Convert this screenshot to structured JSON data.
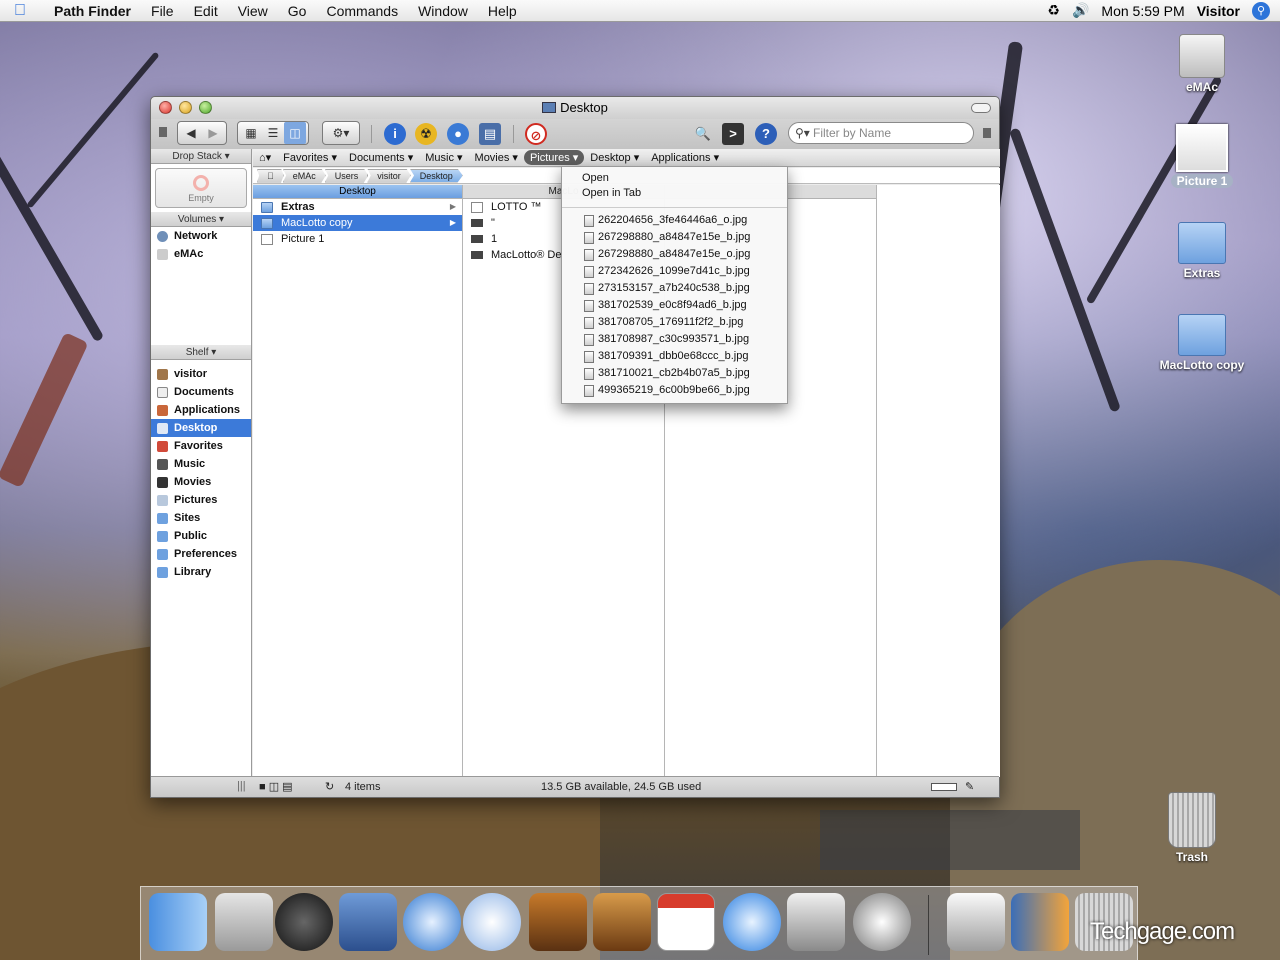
{
  "menubar": {
    "app_name": "Path Finder",
    "items": [
      "File",
      "Edit",
      "View",
      "Go",
      "Commands",
      "Window",
      "Help"
    ],
    "clock": "Mon 5:59 PM",
    "user": "Visitor"
  },
  "desktop_icons": [
    {
      "label": "eMAc"
    },
    {
      "label": "Picture 1"
    },
    {
      "label": "Extras"
    },
    {
      "label": "MacLotto copy"
    },
    {
      "label": "Trash"
    }
  ],
  "window": {
    "title": "Desktop",
    "search_placeholder": "Filter by Name",
    "sidebar": {
      "drop_stack_header": "Drop Stack",
      "drop_stack_empty": "Empty",
      "volumes_header": "Volumes",
      "volumes": [
        "Network",
        "eMAc"
      ],
      "shelf_header": "Shelf",
      "shelf": [
        "visitor",
        "Documents",
        "Applications",
        "Desktop",
        "Favorites",
        "Music",
        "Movies",
        "Pictures",
        "Sites",
        "Public",
        "Preferences",
        "Library"
      ],
      "selected_shelf": "Desktop"
    },
    "favorites_bar": [
      "Favorites",
      "Documents",
      "Music",
      "Movies",
      "Pictures",
      "Desktop",
      "Applications"
    ],
    "open_favorite": "Pictures",
    "breadcrumb": [
      "eMAc",
      "Users",
      "visitor",
      "Desktop"
    ],
    "columns": [
      {
        "header": "Desktop",
        "items": [
          "Extras",
          "MacLotto copy",
          "Picture 1"
        ],
        "selected": "MacLotto copy"
      },
      {
        "header": "MacLo",
        "items": [
          "LOTTO ™",
          "\"",
          "1",
          "MacLotto® De"
        ]
      }
    ],
    "status": {
      "item_count": "4 items",
      "disk_space": "13.5 GB available, 24.5 GB used"
    }
  },
  "pictures_menu": {
    "actions": [
      "Open",
      "Open in Tab"
    ],
    "files": [
      "262204656_3fe46446a6_o.jpg",
      "267298880_a84847e15e_b.jpg",
      "267298880_a84847e15e_o.jpg",
      "272342626_1099e7d41c_b.jpg",
      "273153157_a7b240c538_b.jpg",
      "381702539_e0c8f94ad6_b.jpg",
      "381708705_176911f2f2_b.jpg",
      "381708987_c30c993571_b.jpg",
      "381709391_dbb0e68ccc_b.jpg",
      "381710021_cb2b4b07a5_b.jpg",
      "499365219_6c00b9be66_b.jpg"
    ]
  },
  "watermark": "Techgage.com",
  "colors": {
    "selection": "#3c7ad9",
    "menu_open": "#5f5f5f"
  }
}
